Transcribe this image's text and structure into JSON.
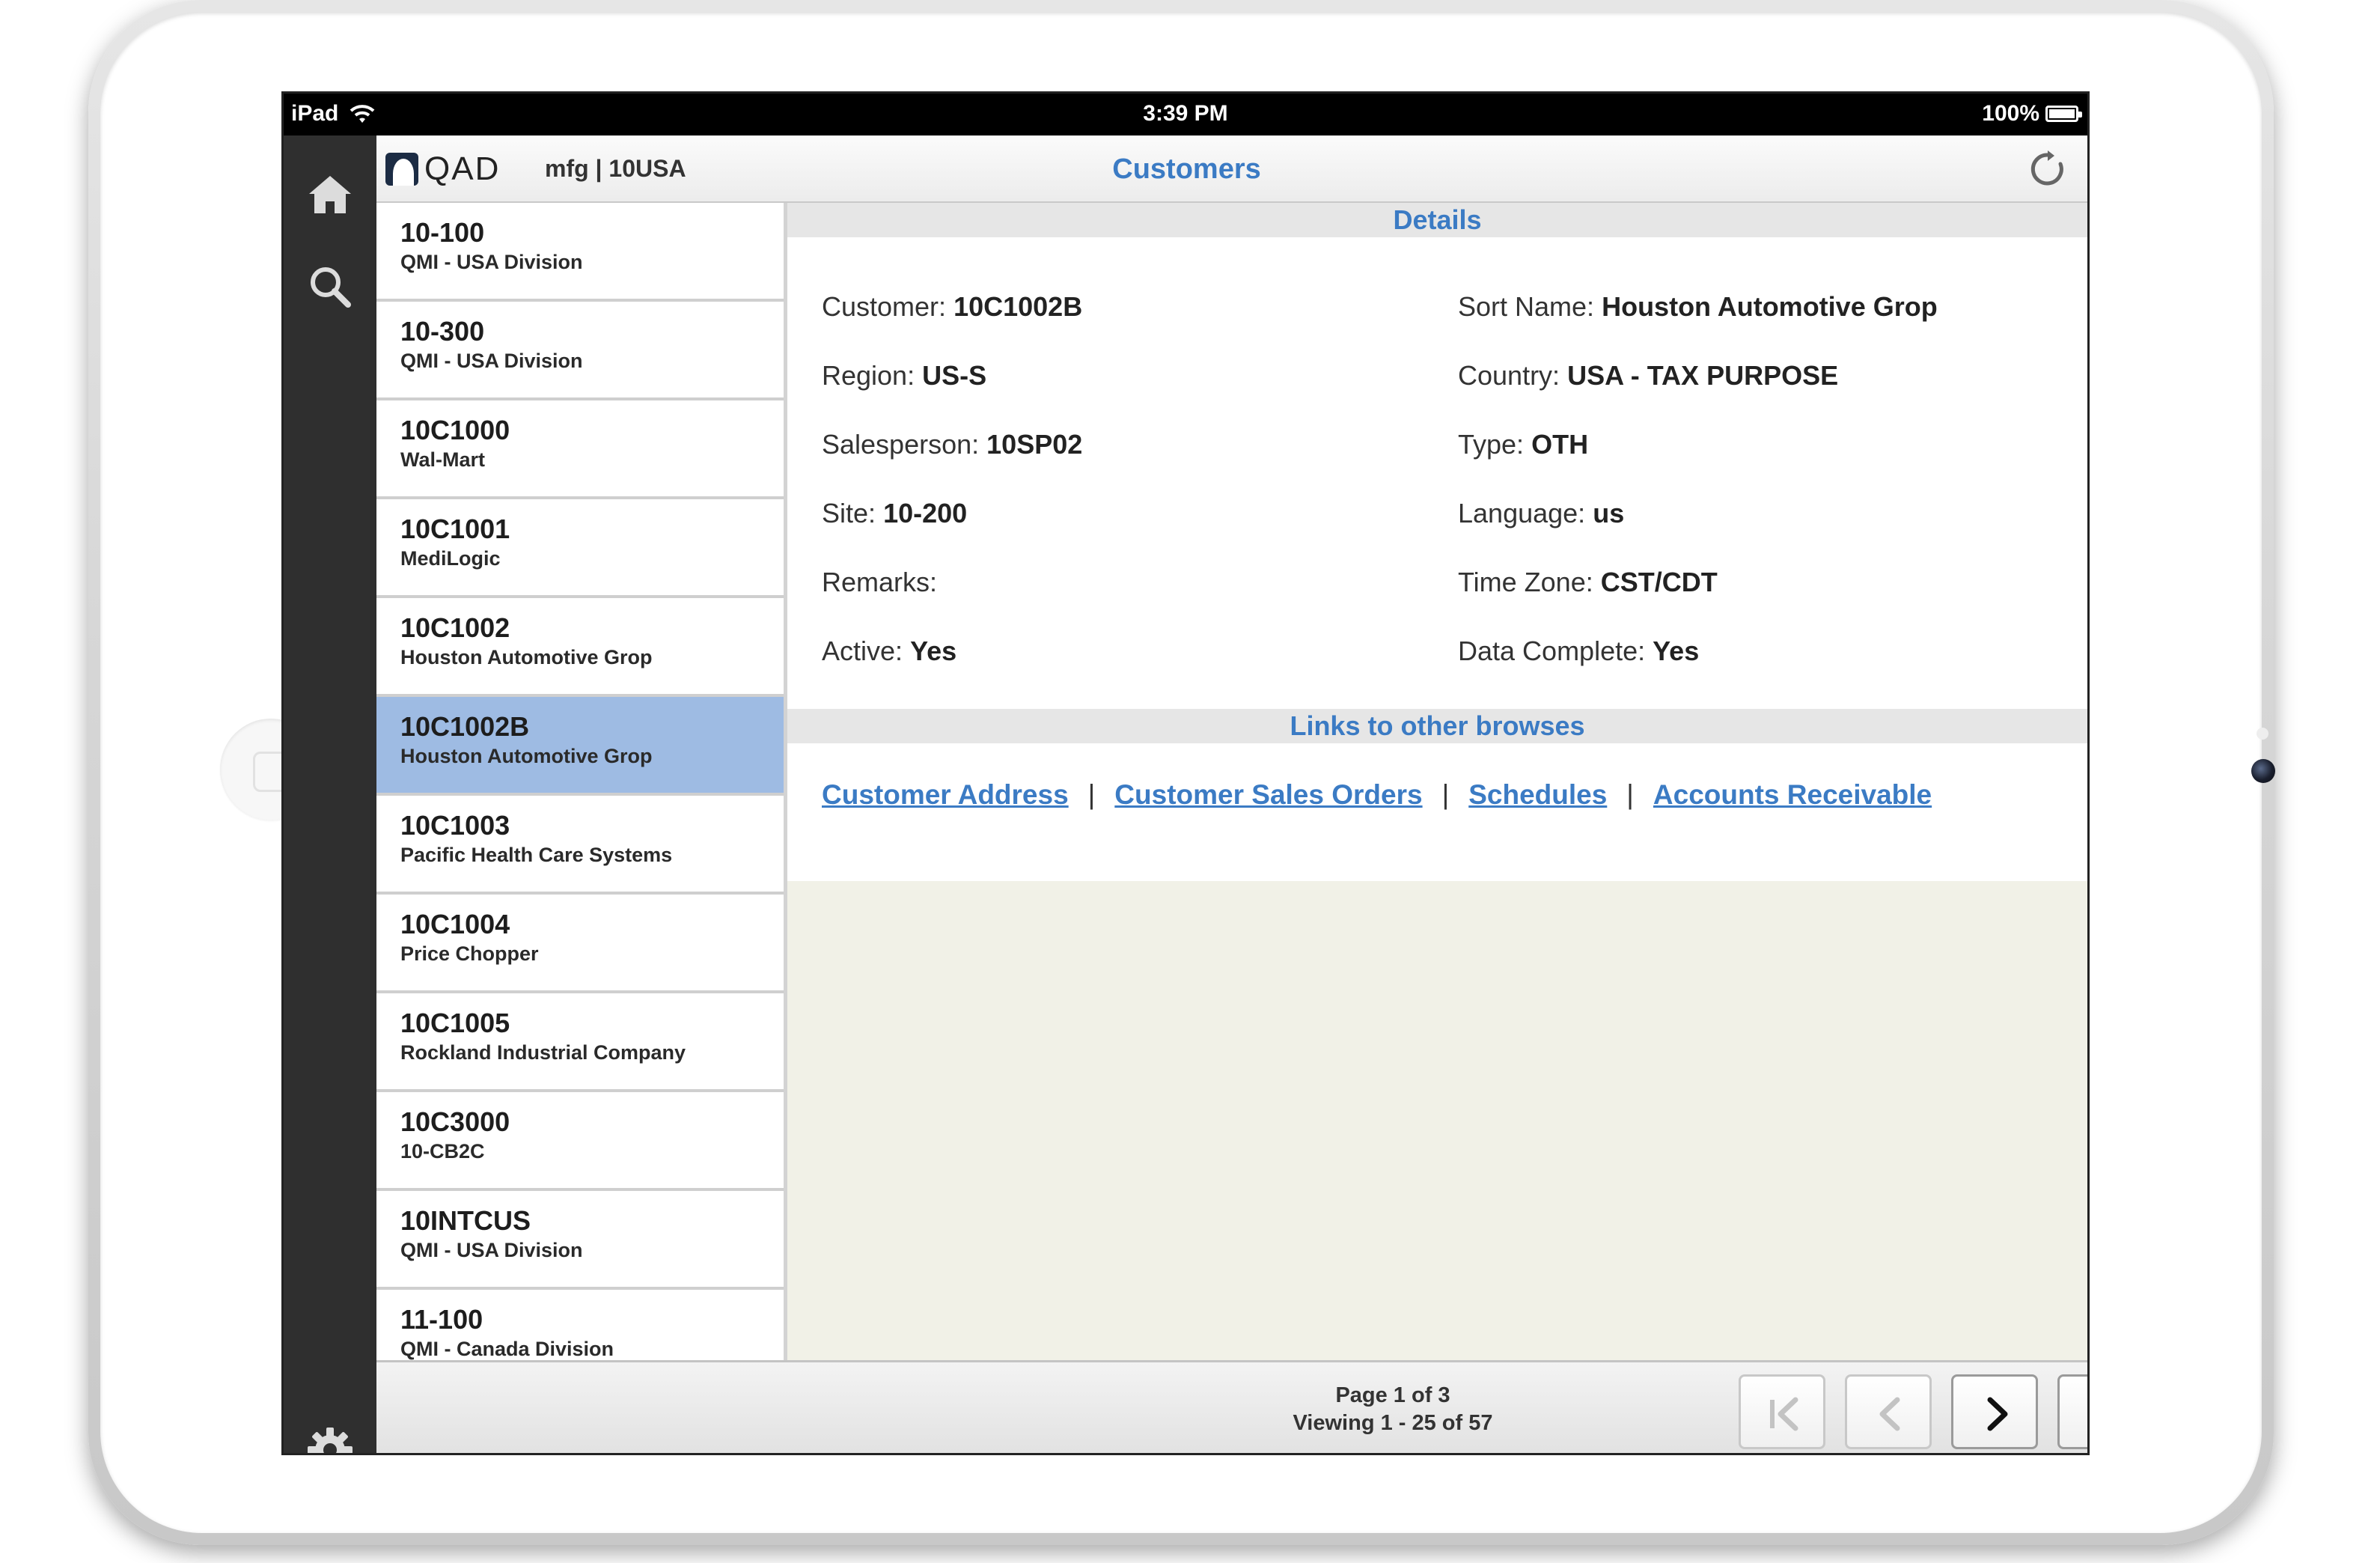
{
  "status_bar": {
    "device": "iPad",
    "time": "3:39 PM",
    "battery": "100%"
  },
  "header": {
    "logo": "QAD",
    "company": "mfg | 10USA",
    "title": "Customers"
  },
  "customers": [
    {
      "code": "10-100",
      "name": "QMI - USA Division"
    },
    {
      "code": "10-300",
      "name": "QMI - USA Division"
    },
    {
      "code": "10C1000",
      "name": "Wal-Mart"
    },
    {
      "code": "10C1001",
      "name": "MediLogic"
    },
    {
      "code": "10C1002",
      "name": "Houston Automotive Grop"
    },
    {
      "code": "10C1002B",
      "name": "Houston Automotive Grop"
    },
    {
      "code": "10C1003",
      "name": "Pacific Health Care Systems"
    },
    {
      "code": "10C1004",
      "name": "Price Chopper"
    },
    {
      "code": "10C1005",
      "name": "Rockland Industrial Company"
    },
    {
      "code": "10C3000",
      "name": "10-CB2C"
    },
    {
      "code": "10INTCUS",
      "name": "QMI - USA Division"
    },
    {
      "code": "11-100",
      "name": "QMI - Canada Division"
    }
  ],
  "details": {
    "section_title": "Details",
    "fields": [
      {
        "label": "Customer:",
        "value": "10C1002B"
      },
      {
        "label": "Sort Name:",
        "value": "Houston Automotive Grop"
      },
      {
        "label": "Region:",
        "value": "US-S"
      },
      {
        "label": "Country:",
        "value": "USA - TAX PURPOSE"
      },
      {
        "label": "Salesperson:",
        "value": "10SP02"
      },
      {
        "label": "Type:",
        "value": "OTH"
      },
      {
        "label": "Site:",
        "value": "10-200"
      },
      {
        "label": "Language:",
        "value": "us"
      },
      {
        "label": "Remarks:",
        "value": ""
      },
      {
        "label": "Time Zone:",
        "value": "CST/CDT"
      },
      {
        "label": "Active:",
        "value": "Yes"
      },
      {
        "label": "Data Complete:",
        "value": "Yes"
      }
    ]
  },
  "links": {
    "section_title": "Links to other browses",
    "items": [
      {
        "label": "Customer Address"
      },
      {
        "label": "Customer Sales Orders"
      },
      {
        "label": "Schedules"
      },
      {
        "label": "Accounts Receivable"
      }
    ],
    "separator": "|"
  },
  "pagination": {
    "page": "Page 1 of 3",
    "viewing": "Viewing 1 - 25 of 57"
  },
  "icons": [
    "home-icon",
    "search-icon",
    "settings-icon",
    "refresh-icon",
    "first-page-icon",
    "previous-page-icon",
    "next-page-icon",
    "last-page-icon",
    "wifi-icon",
    "battery-icon"
  ]
}
